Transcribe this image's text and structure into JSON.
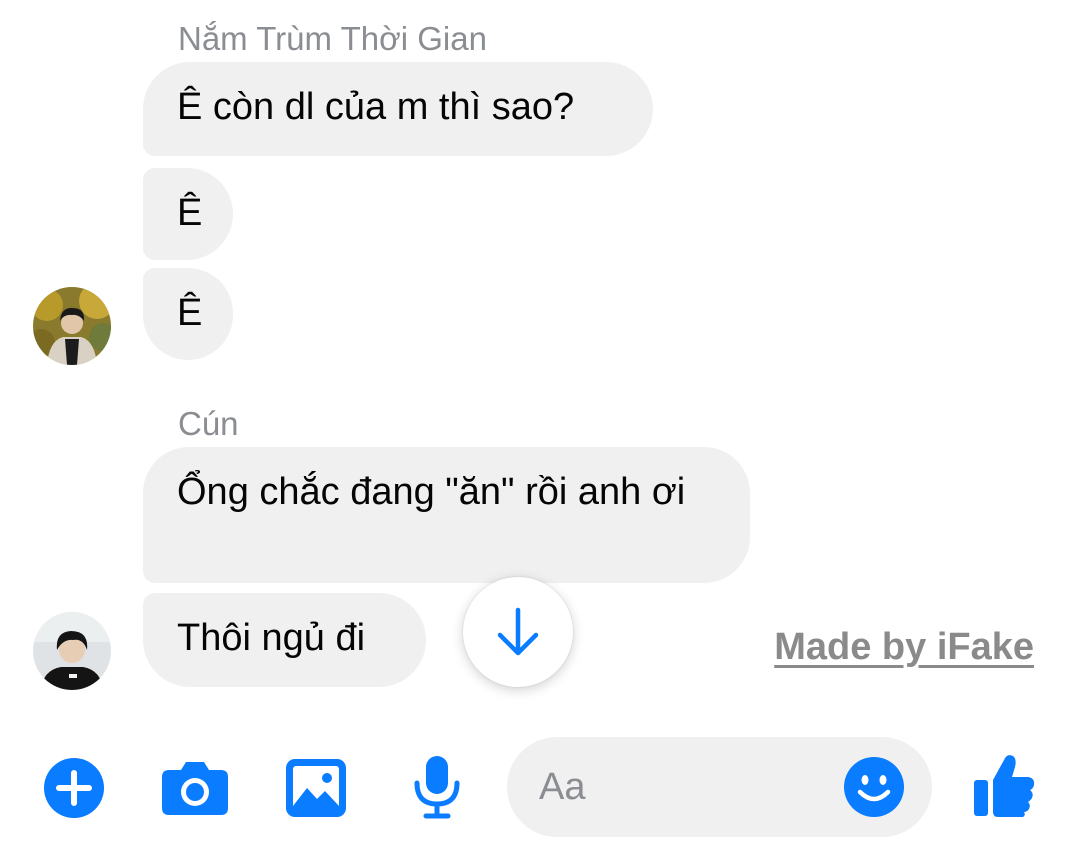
{
  "thread": [
    {
      "sender": "Nắm Trùm Thời Gian",
      "messages": [
        "Ê còn dl của m thì sao?",
        "Ê",
        "Ê"
      ]
    },
    {
      "sender": "Cún",
      "messages": [
        "Ổng chắc đang \"ăn\" rồi anh ơi",
        "Thôi ngủ đi"
      ]
    }
  ],
  "watermark": "Made by iFake",
  "composer": {
    "placeholder": "Aa"
  },
  "icons": {
    "scroll_down": "arrow-down-icon",
    "add": "plus-circle-icon",
    "camera": "camera-icon",
    "gallery": "image-icon",
    "voice": "microphone-icon",
    "emoji": "smiley-icon",
    "like": "thumbs-up-icon"
  },
  "colors": {
    "accent": "#0a7cff",
    "bubble": "#f0f0f0",
    "sender_name": "#8a8d91",
    "watermark": "#8a8a8a"
  }
}
